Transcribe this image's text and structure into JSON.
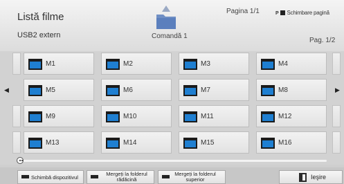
{
  "header": {
    "title": "Listă filme",
    "device": "USB2 extern",
    "command": "Comandă 1",
    "page_top": "Pagina 1/1",
    "switch_page_key": "P",
    "switch_page": "Schimbare pagină",
    "page_right": "Pag. 1/2"
  },
  "grid": {
    "items": [
      "M1",
      "M2",
      "M3",
      "M4",
      "M5",
      "M6",
      "M7",
      "M8",
      "M9",
      "M10",
      "M11",
      "M12",
      "M13",
      "M14",
      "M15",
      "M16"
    ]
  },
  "footer": {
    "change_device": "Schimbă dispozitivul",
    "go_root_line1": "Mergeți la folderul",
    "go_root_line2": "rădăcină",
    "go_up_line1": "Mergeți la folderul",
    "go_up_line2": "superior",
    "exit": "Ieşire"
  },
  "colors": {
    "folder_blue": "#1f7fd1",
    "folder_dark": "#1a1a1a"
  }
}
